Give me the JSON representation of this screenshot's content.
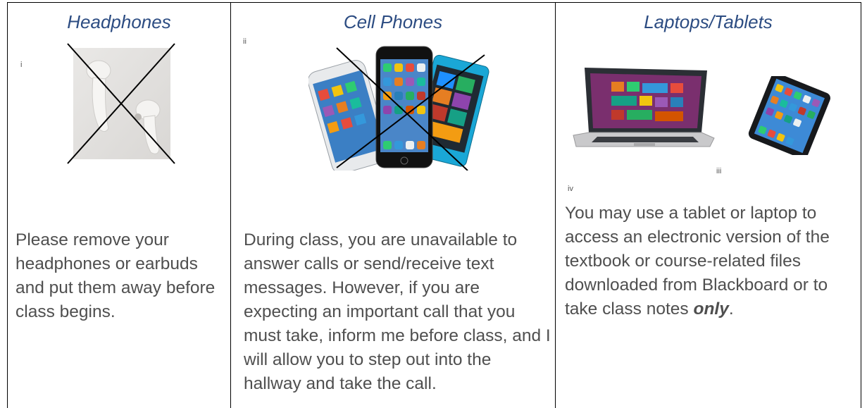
{
  "columns": [
    {
      "title": "Headphones",
      "footnote": "i",
      "text": "Please remove your headphones or earbuds and put them away before class begins.",
      "image": "earbuds-crossed-out"
    },
    {
      "title": "Cell Phones",
      "footnote": "ii",
      "text": "During class, you are unavailable to answer calls or send/receive text messages. However, if you are expecting an important call that you must take, inform me before class, and I will allow you to step out into the hallway and take the call.",
      "image": "phones-crossed-out"
    },
    {
      "title": "Laptops/Tablets",
      "footnotes": [
        "iii",
        "iv"
      ],
      "text_before": "You may use a tablet or laptop to access an electronic version of the textbook or course-related files downloaded from Blackboard or to take class notes ",
      "text_emphasis": "only",
      "text_after": ".",
      "images": [
        "laptop",
        "tablet"
      ]
    }
  ],
  "colors": {
    "title": "#2c4c82",
    "body": "#4f4f4f",
    "border": "#000000"
  }
}
